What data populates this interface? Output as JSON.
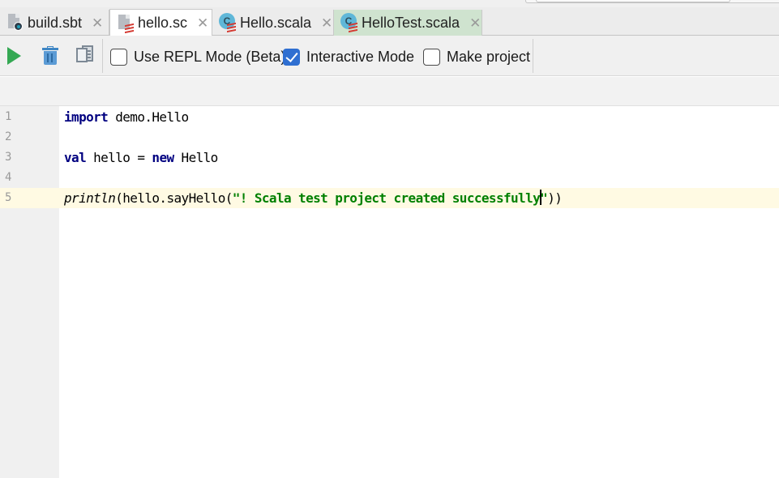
{
  "tabs": [
    {
      "label": "build.sbt",
      "icon": "sbt-file-icon",
      "active": false
    },
    {
      "label": "hello.sc",
      "icon": "scala-worksheet-icon",
      "active": true
    },
    {
      "label": "Hello.scala",
      "icon": "scala-class-icon",
      "active": false
    },
    {
      "label": "HelloTest.scala",
      "icon": "scala-test-class-icon",
      "active": false
    }
  ],
  "tab_close_glyph": "✕",
  "class_icon_letter": "C",
  "toolbar": {
    "run_icon": "run-icon",
    "clean_icon": "trash-icon",
    "copy_icon": "copy-icon",
    "options": [
      {
        "label": "Use REPL Mode (Beta)",
        "checked": false
      },
      {
        "label": "Interactive Mode",
        "checked": true
      },
      {
        "label": "Make project",
        "checked": false
      }
    ]
  },
  "editor": {
    "current_line": 5,
    "lines": [
      {
        "number": "1",
        "tokens": [
          {
            "t": "import",
            "k": "kw"
          },
          {
            "t": " demo.Hello",
            "k": ""
          }
        ]
      },
      {
        "number": "2",
        "tokens": []
      },
      {
        "number": "3",
        "tokens": [
          {
            "t": "val",
            "k": "kw"
          },
          {
            "t": " hello = ",
            "k": ""
          },
          {
            "t": "new",
            "k": "kw"
          },
          {
            "t": " Hello",
            "k": ""
          }
        ]
      },
      {
        "number": "4",
        "tokens": []
      },
      {
        "number": "5",
        "tokens": [
          {
            "t": "println",
            "k": "fn"
          },
          {
            "t": "(hello.sayHello(",
            "k": ""
          },
          {
            "t": "\"! Scala test project created successfully",
            "k": "str"
          },
          {
            "t": "|",
            "k": "caret"
          },
          {
            "t": "\"",
            "k": "str"
          },
          {
            "t": "))",
            "k": ""
          }
        ]
      }
    ]
  },
  "colors": {
    "keyword": "#000080",
    "string": "#008000",
    "current_line": "#fffae3",
    "checkbox_checked": "#2f6fd1",
    "test_tab": "#cfe3cf"
  }
}
